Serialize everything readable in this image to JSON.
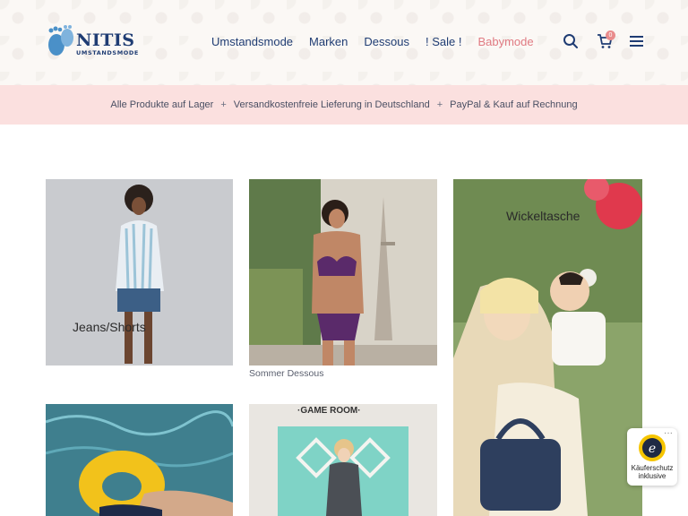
{
  "header": {
    "logo_text": "NITIS",
    "logo_subtitle": "UMSTANDSMODE",
    "nav": [
      {
        "label": "Umstandsmode"
      },
      {
        "label": "Marken"
      },
      {
        "label": "Dessous"
      },
      {
        "label": "! Sale !"
      },
      {
        "label": "Babymode",
        "accent": true
      }
    ],
    "cart_count": "0",
    "icons": [
      "search-icon",
      "cart-icon",
      "menu-icon"
    ],
    "colors": {
      "brand": "#1f3c73",
      "accent": "#e07a82",
      "promo_bg": "#fbe0df"
    }
  },
  "promo": {
    "items": [
      "Alle Produkte auf Lager",
      "Versandkostenfreie Lieferung in Deutschland",
      "PayPal & Kauf auf Rechnung"
    ],
    "separator": "+"
  },
  "tiles": {
    "jeans": {
      "label": "Jeans/Shorts"
    },
    "dessous": {
      "caption": "Sommer Dessous"
    },
    "wickel": {
      "label": "Wickeltasche"
    },
    "gameroom": {
      "sign": "·GAME ROOM·"
    }
  },
  "trust_badge": {
    "logo_letter": "e",
    "line1": "Käuferschutz",
    "line2": "inklusive",
    "more": "···"
  }
}
